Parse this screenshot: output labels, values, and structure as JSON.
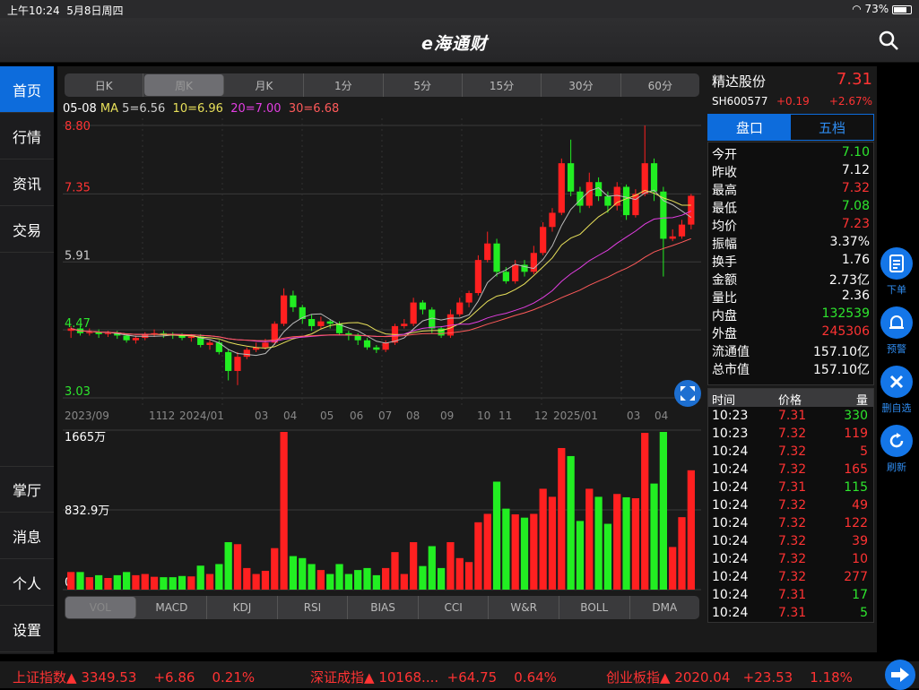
{
  "status": {
    "time": "上午10:24",
    "date": "5月8日周四",
    "battery": "73%"
  },
  "app": {
    "logo": "e海通财"
  },
  "nav": {
    "top": [
      {
        "label": "首页"
      },
      {
        "label": "行情"
      },
      {
        "label": "资讯"
      },
      {
        "label": "交易"
      }
    ],
    "bottom": [
      {
        "label": "掌厅"
      },
      {
        "label": "消息"
      },
      {
        "label": "个人"
      },
      {
        "label": "设置"
      }
    ]
  },
  "periods": [
    "日K",
    "周K",
    "月K",
    "1分",
    "5分",
    "15分",
    "30分",
    "60分"
  ],
  "selected_period": "周K",
  "ma": {
    "date": "05-08",
    "label": "MA",
    "ma5": "5=6.56",
    "ma10": "10=6.96",
    "ma20": "20=7.00",
    "ma30": "30=6.68"
  },
  "price_axis": [
    "8.80",
    "7.35",
    "5.91",
    "4.47",
    "3.03"
  ],
  "date_axis": [
    "2023/09",
    "11",
    "12",
    "2024/01",
    "03",
    "04",
    "05",
    "06",
    "07",
    "08",
    "09",
    "10",
    "11",
    "12",
    "2025/01",
    "03",
    "04"
  ],
  "vol_axis": [
    "1665万",
    "832.9万",
    "0"
  ],
  "indicators": [
    "VOL",
    "MACD",
    "KDJ",
    "RSI",
    "BIAS",
    "CCI",
    "W&R",
    "BOLL",
    "DMA"
  ],
  "selected_indicator": "VOL",
  "stock": {
    "name": "精达股份",
    "price": "7.31",
    "code": "SH600577",
    "change": "+0.19",
    "pct": "+2.67%"
  },
  "tabs": [
    "盘口",
    "五档"
  ],
  "stats": [
    {
      "k": "今开",
      "v": "7.10",
      "c": "green"
    },
    {
      "k": "昨收",
      "v": "7.12",
      "c": "white"
    },
    {
      "k": "最高",
      "v": "7.32",
      "c": "red"
    },
    {
      "k": "最低",
      "v": "7.08",
      "c": "green"
    },
    {
      "k": "均价",
      "v": "7.23",
      "c": "red"
    },
    {
      "k": "振幅",
      "v": "3.37%",
      "c": "white"
    },
    {
      "k": "换手",
      "v": "1.76",
      "c": "white"
    },
    {
      "k": "金额",
      "v": "2.73亿",
      "c": "white"
    },
    {
      "k": "量比",
      "v": "2.36",
      "c": "white"
    },
    {
      "k": "内盘",
      "v": "132539",
      "c": "green"
    },
    {
      "k": "外盘",
      "v": "245306",
      "c": "red"
    },
    {
      "k": "流通值",
      "v": "157.10亿",
      "c": "white"
    },
    {
      "k": "总市值",
      "v": "157.10亿",
      "c": "white"
    }
  ],
  "trade_headers": [
    "时间",
    "价格",
    "量"
  ],
  "trades": [
    {
      "t": "10:23",
      "p": "7.31",
      "q": "330",
      "qc": "green"
    },
    {
      "t": "10:23",
      "p": "7.32",
      "q": "119",
      "qc": "red"
    },
    {
      "t": "10:24",
      "p": "7.32",
      "q": "5",
      "qc": "red"
    },
    {
      "t": "10:24",
      "p": "7.32",
      "q": "165",
      "qc": "red"
    },
    {
      "t": "10:24",
      "p": "7.31",
      "q": "115",
      "qc": "green"
    },
    {
      "t": "10:24",
      "p": "7.32",
      "q": "49",
      "qc": "red"
    },
    {
      "t": "10:24",
      "p": "7.32",
      "q": "122",
      "qc": "red"
    },
    {
      "t": "10:24",
      "p": "7.32",
      "q": "39",
      "qc": "red"
    },
    {
      "t": "10:24",
      "p": "7.32",
      "q": "10",
      "qc": "red"
    },
    {
      "t": "10:24",
      "p": "7.32",
      "q": "277",
      "qc": "red"
    },
    {
      "t": "10:24",
      "p": "7.31",
      "q": "17",
      "qc": "green"
    },
    {
      "t": "10:24",
      "p": "7.31",
      "q": "5",
      "qc": "green"
    }
  ],
  "side_actions": [
    {
      "label": "下单",
      "icon": "order-icon"
    },
    {
      "label": "预警",
      "icon": "bell-icon"
    },
    {
      "label": "删自选",
      "icon": "close-icon"
    },
    {
      "label": "刷新",
      "icon": "refresh-icon"
    }
  ],
  "ticker": [
    {
      "name": "上证指数▲",
      "value": "3349.53",
      "chg": "+6.86",
      "pct": "0.21%"
    },
    {
      "name": "深证成指▲",
      "value": "10168....",
      "chg": "+64.75",
      "pct": "0.64%"
    },
    {
      "name": "创业板指▲",
      "value": "2020.04",
      "chg": "+23.53",
      "pct": "1.18%"
    }
  ],
  "chart_data": {
    "type": "candlestick",
    "ylim": [
      3.03,
      8.8
    ],
    "candles": [
      [
        4.45,
        4.5,
        4.55,
        4.3
      ],
      [
        4.5,
        4.4,
        4.55,
        4.35
      ],
      [
        4.4,
        4.42,
        4.5,
        4.35
      ],
      [
        4.42,
        4.38,
        4.48,
        4.3
      ],
      [
        4.38,
        4.4,
        4.45,
        4.32
      ],
      [
        4.4,
        4.35,
        4.45,
        4.28
      ],
      [
        4.35,
        4.25,
        4.4,
        4.2
      ],
      [
        4.25,
        4.3,
        4.35,
        4.18
      ],
      [
        4.3,
        4.38,
        4.42,
        4.25
      ],
      [
        4.38,
        4.4,
        4.48,
        4.32
      ],
      [
        4.4,
        4.38,
        4.45,
        4.3
      ],
      [
        4.38,
        4.35,
        4.42,
        4.28
      ],
      [
        4.35,
        4.3,
        4.4,
        4.25
      ],
      [
        4.3,
        4.33,
        4.38,
        4.22
      ],
      [
        4.33,
        4.15,
        4.38,
        4.1
      ],
      [
        4.15,
        4.2,
        4.25,
        4.05
      ],
      [
        4.2,
        4.0,
        4.25,
        3.95
      ],
      [
        4.0,
        3.6,
        4.05,
        3.4
      ],
      [
        3.6,
        3.9,
        4.0,
        3.3
      ],
      [
        3.9,
        4.05,
        4.1,
        3.85
      ],
      [
        4.05,
        4.1,
        4.2,
        4.0
      ],
      [
        4.1,
        4.2,
        4.28,
        4.05
      ],
      [
        4.2,
        4.6,
        4.65,
        4.15
      ],
      [
        4.6,
        5.2,
        5.35,
        4.55
      ],
      [
        5.2,
        4.95,
        5.3,
        4.85
      ],
      [
        4.95,
        4.7,
        5.0,
        4.6
      ],
      [
        4.7,
        4.55,
        4.8,
        4.45
      ],
      [
        4.55,
        4.65,
        4.75,
        4.5
      ],
      [
        4.65,
        4.6,
        4.7,
        4.5
      ],
      [
        4.6,
        4.4,
        4.65,
        4.35
      ],
      [
        4.4,
        4.35,
        4.45,
        4.25
      ],
      [
        4.35,
        4.25,
        4.4,
        4.15
      ],
      [
        4.25,
        4.1,
        4.3,
        4.05
      ],
      [
        4.1,
        4.05,
        4.15,
        3.98
      ],
      [
        4.05,
        4.2,
        4.25,
        4.0
      ],
      [
        4.2,
        4.55,
        4.6,
        4.15
      ],
      [
        4.55,
        4.6,
        4.7,
        4.5
      ],
      [
        4.6,
        5.05,
        5.15,
        4.55
      ],
      [
        5.05,
        4.9,
        5.1,
        4.8
      ],
      [
        4.9,
        4.5,
        4.95,
        4.4
      ],
      [
        4.5,
        4.35,
        4.55,
        4.3
      ],
      [
        4.35,
        4.8,
        4.9,
        4.3
      ],
      [
        4.8,
        5.05,
        5.15,
        4.75
      ],
      [
        5.05,
        5.25,
        5.3,
        4.95
      ],
      [
        5.25,
        5.95,
        6.05,
        5.2
      ],
      [
        5.95,
        6.3,
        6.55,
        5.9
      ],
      [
        6.3,
        5.7,
        6.4,
        5.6
      ],
      [
        5.7,
        5.5,
        5.8,
        5.45
      ],
      [
        5.5,
        5.85,
        5.95,
        5.45
      ],
      [
        5.85,
        5.7,
        5.95,
        5.6
      ],
      [
        5.7,
        6.1,
        6.25,
        5.65
      ],
      [
        6.1,
        6.65,
        6.75,
        6.05
      ],
      [
        6.65,
        6.95,
        7.05,
        6.55
      ],
      [
        6.95,
        8.0,
        8.1,
        6.9
      ],
      [
        8.0,
        7.4,
        8.5,
        7.3
      ],
      [
        7.4,
        7.1,
        7.5,
        6.95
      ],
      [
        7.1,
        7.6,
        7.8,
        7.05
      ],
      [
        7.6,
        7.3,
        7.7,
        7.2
      ],
      [
        7.3,
        7.1,
        7.4,
        6.95
      ],
      [
        7.1,
        7.5,
        7.6,
        7.0
      ],
      [
        7.5,
        6.9,
        7.55,
        6.8
      ],
      [
        6.9,
        7.35,
        7.45,
        6.85
      ],
      [
        7.35,
        8.0,
        8.8,
        7.3
      ],
      [
        8.0,
        7.4,
        8.1,
        7.2
      ],
      [
        7.4,
        6.4,
        7.5,
        5.6
      ],
      [
        6.4,
        6.45,
        6.6,
        6.35
      ],
      [
        6.45,
        6.7,
        6.8,
        6.4
      ],
      [
        6.7,
        7.31,
        7.35,
        6.6
      ]
    ],
    "volume_max": 1665
  }
}
